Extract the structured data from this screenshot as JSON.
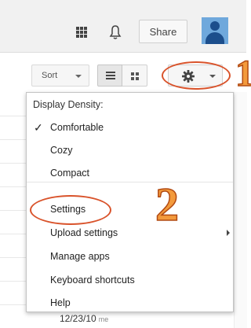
{
  "header": {
    "share_label": "Share",
    "icons": [
      "apps-grid-icon",
      "notifications-bell-icon",
      "avatar"
    ]
  },
  "toolbar": {
    "sort_label": "Sort"
  },
  "menu": {
    "header": "Display Density:",
    "density_options": [
      {
        "label": "Comfortable",
        "checked": true
      },
      {
        "label": "Cozy",
        "checked": false
      },
      {
        "label": "Compact",
        "checked": false
      }
    ],
    "items": [
      {
        "label": "Settings"
      },
      {
        "label": "Upload settings",
        "has_submenu": true
      },
      {
        "label": "Manage apps"
      },
      {
        "label": "Keyboard shortcuts"
      },
      {
        "label": "Help"
      }
    ]
  },
  "annotations": {
    "step1": "1",
    "step2": "2",
    "color": "#d9532b"
  },
  "list": {
    "date": "12/23/10",
    "owner": "me"
  },
  "colors": {
    "accent": "#d9532b",
    "number_fill": "#f39a3c"
  }
}
